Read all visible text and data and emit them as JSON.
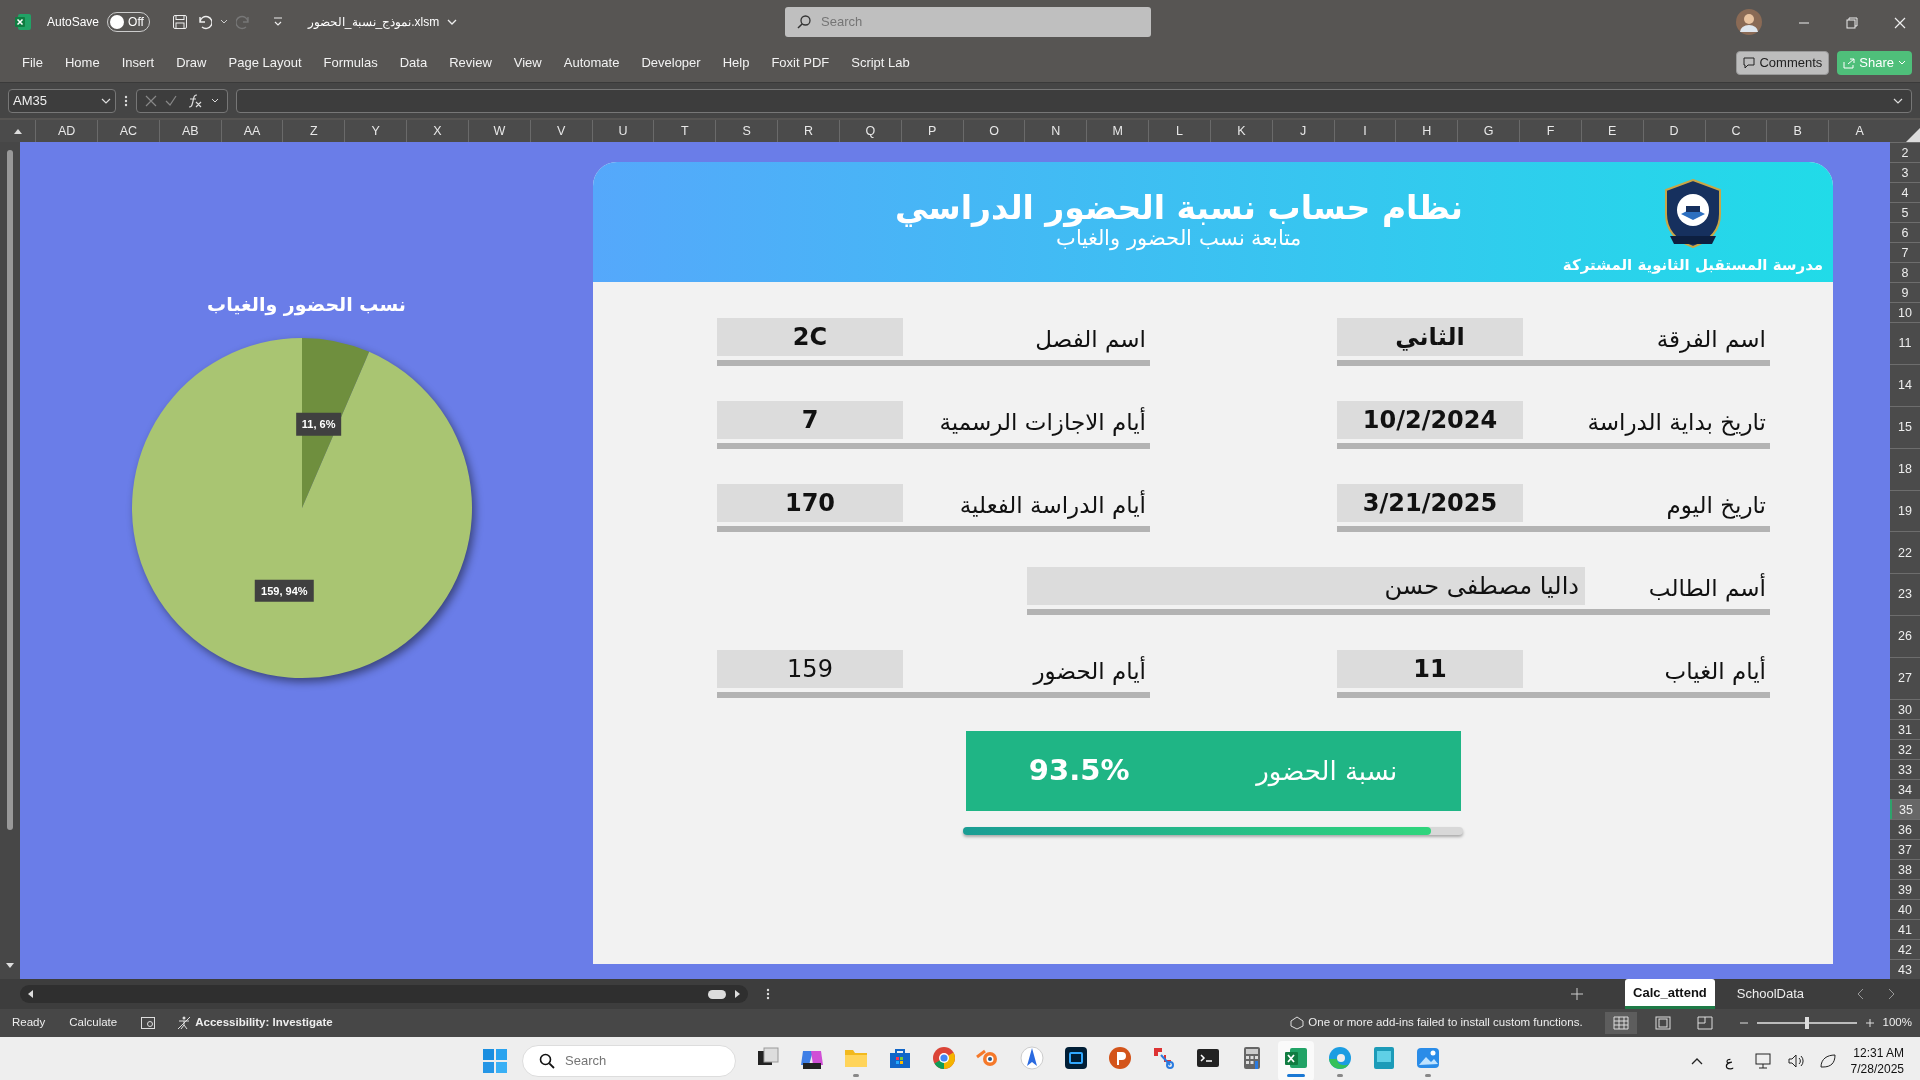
{
  "titlebar": {
    "autosave_label": "AutoSave",
    "autosave": {
      "on": false,
      "label": "Off"
    },
    "filename": "نموذج_نسبة_الحضور.xlsm",
    "search": {
      "placeholder": "Search"
    }
  },
  "ribbon_tabs": [
    "Script Lab",
    "Foxit PDF",
    "Help",
    "Developer",
    "Automate",
    "View",
    "Review",
    "Data",
    "Formulas",
    "Page Layout",
    "Draw",
    "Insert",
    "Home",
    "File"
  ],
  "ribbon_buttons": {
    "comments": "Comments",
    "share": "Share"
  },
  "formula_bar": {
    "name_box": "AM35"
  },
  "columns": [
    "A",
    "B",
    "C",
    "D",
    "E",
    "F",
    "G",
    "H",
    "I",
    "J",
    "K",
    "L",
    "M",
    "N",
    "O",
    "P",
    "Q",
    "R",
    "S",
    "T",
    "U",
    "V",
    "W",
    "X",
    "Y",
    "Z",
    "AA",
    "AB",
    "AC",
    "AD"
  ],
  "rows": [
    {
      "label": "2",
      "kind": "normal",
      "selected": false
    },
    {
      "label": "3",
      "kind": "normal",
      "selected": false
    },
    {
      "label": "4",
      "kind": "normal",
      "selected": false
    },
    {
      "label": "5",
      "kind": "normal",
      "selected": false
    },
    {
      "label": "6",
      "kind": "normal",
      "selected": false
    },
    {
      "label": "7",
      "kind": "normal",
      "selected": false
    },
    {
      "label": "8",
      "kind": "normal",
      "selected": false
    },
    {
      "label": "9",
      "kind": "normal",
      "selected": false
    },
    {
      "label": "10",
      "kind": "normal",
      "selected": false
    },
    {
      "label": "11",
      "kind": "tall",
      "selected": false
    },
    {
      "label": "14",
      "kind": "tall",
      "selected": false
    },
    {
      "label": "15",
      "kind": "tall",
      "selected": false
    },
    {
      "label": "18",
      "kind": "tall",
      "selected": false
    },
    {
      "label": "19",
      "kind": "tall",
      "selected": false
    },
    {
      "label": "22",
      "kind": "tall",
      "selected": false
    },
    {
      "label": "23",
      "kind": "tall",
      "selected": false
    },
    {
      "label": "26",
      "kind": "tall",
      "selected": false
    },
    {
      "label": "27",
      "kind": "tall",
      "selected": false
    },
    {
      "label": "30",
      "kind": "normal",
      "selected": false
    },
    {
      "label": "31",
      "kind": "normal",
      "selected": false
    },
    {
      "label": "32",
      "kind": "normal",
      "selected": false
    },
    {
      "label": "33",
      "kind": "normal",
      "selected": false
    },
    {
      "label": "34",
      "kind": "normal",
      "selected": false
    },
    {
      "label": "35",
      "kind": "normal",
      "selected": true
    },
    {
      "label": "36",
      "kind": "normal",
      "selected": false
    },
    {
      "label": "37",
      "kind": "normal",
      "selected": false
    },
    {
      "label": "38",
      "kind": "normal",
      "selected": false
    },
    {
      "label": "39",
      "kind": "normal",
      "selected": false
    },
    {
      "label": "40",
      "kind": "normal",
      "selected": false
    },
    {
      "label": "41",
      "kind": "normal",
      "selected": false
    },
    {
      "label": "42",
      "kind": "normal",
      "selected": false
    },
    {
      "label": "43",
      "kind": "normal",
      "selected": false
    }
  ],
  "chart": {
    "chart_data": {
      "type": "pie",
      "title": "نسب الحضور والغياب",
      "values": [
        11,
        159
      ],
      "colors": [
        "#6f8f3e",
        "#a9c572"
      ],
      "data_labels": true,
      "value_labels": [
        "11, 6%",
        "159, 94%"
      ]
    }
  },
  "dashboard": {
    "title": "نظام حساب نسبة الحضور الدراسي",
    "subtitle": "متابعة نسب الحضور والغياب",
    "school": "مدرسة المستقبل الثانوية المشتركة",
    "fields": [
      {
        "label": "اسم الفرقة",
        "value": "الثاني",
        "bold": true,
        "kind": "half"
      },
      {
        "label": "اسم الفصل",
        "value": "2C",
        "bold": true,
        "kind": "half"
      },
      {
        "label": "تاريخ بداية الدراسة",
        "value": "10/2/2024",
        "bold": true,
        "kind": "half"
      },
      {
        "label": "أيام الاجازات الرسمية",
        "value": "7",
        "bold": true,
        "kind": "half"
      },
      {
        "label": "تاريخ اليوم",
        "value": "3/21/2025",
        "bold": true,
        "kind": "half"
      },
      {
        "label": "أيام الدراسة الفعلية",
        "value": "170",
        "bold": true,
        "kind": "half"
      },
      {
        "label": "أسم الطالب",
        "value": "داليا مصطفى حسن",
        "bold": false,
        "kind": "wide"
      },
      {
        "label": "أيام الغياب",
        "value": "11",
        "bold": true,
        "kind": "half"
      },
      {
        "label": "أيام الحضور",
        "value": "159",
        "bold": false,
        "kind": "half"
      }
    ],
    "attendance": {
      "label": "نسبة الحضور",
      "value": "93.5%",
      "level": 0.935
    }
  },
  "sheet_tabs": [
    {
      "label": "SchoolData",
      "selected": false
    },
    {
      "label": "Calc_attend",
      "selected": true
    }
  ],
  "status_bar": {
    "ready": "Ready",
    "calculate": "Calculate",
    "accessibility": "Accessibility: Investigate",
    "addins": "One or more add-ins failed to install custom functions.",
    "views": [
      {
        "selected": true
      },
      {
        "selected": false
      },
      {
        "selected": false
      }
    ],
    "zoom": {
      "level": 0.5,
      "label": "100%"
    }
  },
  "taskbar": {
    "search": {
      "placeholder": "Search"
    },
    "apps": [
      {
        "running": false,
        "active": false
      },
      {
        "running": false,
        "active": false
      },
      {
        "running": true,
        "active": false
      },
      {
        "running": false,
        "active": false
      },
      {
        "running": false,
        "active": false
      },
      {
        "running": false,
        "active": false
      },
      {
        "running": false,
        "active": false
      },
      {
        "running": false,
        "active": false
      },
      {
        "running": false,
        "active": false
      },
      {
        "running": false,
        "active": false
      },
      {
        "running": false,
        "active": false
      },
      {
        "running": false,
        "active": false
      },
      {
        "running": true,
        "active": true
      },
      {
        "running": true,
        "active": false
      },
      {
        "running": false,
        "active": false
      },
      {
        "running": true,
        "active": false
      }
    ],
    "language": "ع",
    "time": "12:31 AM",
    "date": "7/28/2025"
  }
}
